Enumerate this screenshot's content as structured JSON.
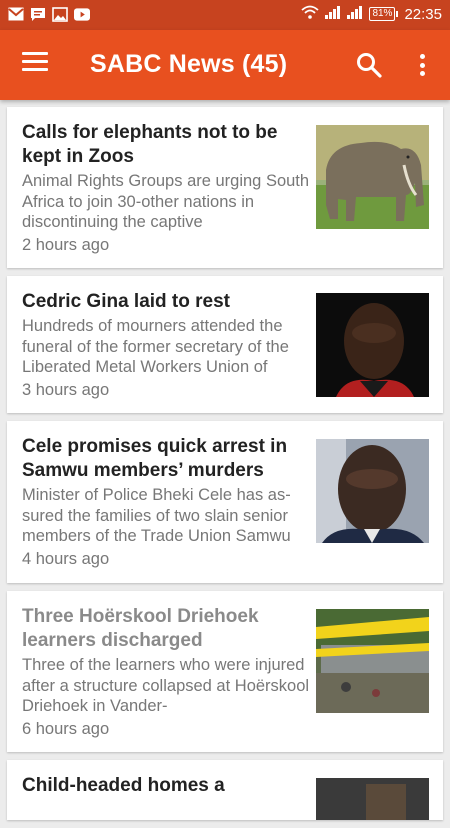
{
  "status_bar": {
    "icons": [
      "gmail-icon",
      "message-icon",
      "gallery-icon",
      "youtube-icon"
    ],
    "battery": "81%",
    "time": "22:35"
  },
  "app_bar": {
    "title": "SABC News (45)"
  },
  "colors": {
    "app_bar": "#e8501f",
    "status_bar": "#c7431f",
    "background": "#ececec"
  },
  "articles": [
    {
      "title": "Calls for elephants not to be kept in Zoos",
      "summary": "Animal Rights Groups are urging South Africa to join 30-other nations in discontinuing the captive",
      "time": "2 hours ago",
      "image": "elephant-image",
      "read": false
    },
    {
      "title": "Cedric Gina laid to rest",
      "summary": "Hundreds of mourners attended the funeral of the former secretary of the Liberated Metal Workers Union of",
      "time": "3 hours ago",
      "image": "cedric-gina-photo",
      "read": false
    },
    {
      "title": "Cele promises quick arrest in Samwu members’ murders",
      "summary": "Minister of Police Bheki Cele has as-sured the families of two slain senior members of the Trade Union Samwu",
      "time": "4 hours ago",
      "image": "bheki-cele-photo",
      "read": false
    },
    {
      "title": "Three Hoërskool Driehoek learners discharged",
      "summary": "Three of the learners who were injured after a structure collapsed at Hoërskool Driehoek in Vander-",
      "time": "6 hours ago",
      "image": "collapse-scene-photo",
      "read": true
    },
    {
      "title": "Child-headed homes a",
      "summary": "",
      "time": "",
      "image": "child-homes-photo",
      "read": false
    }
  ]
}
